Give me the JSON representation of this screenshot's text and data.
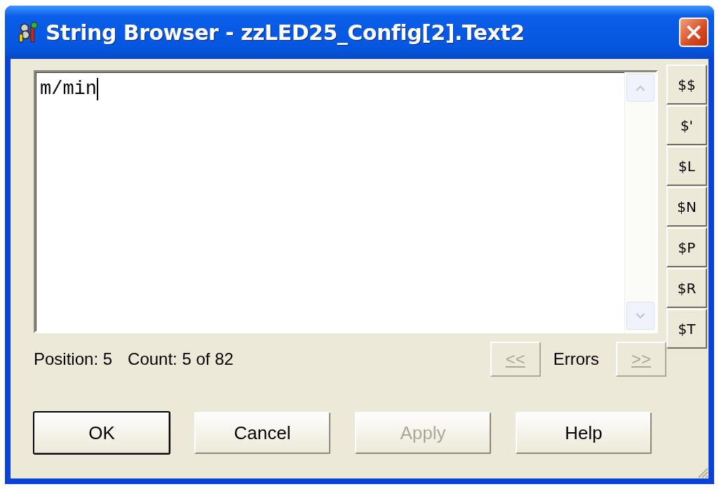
{
  "window": {
    "title": "String Browser - zzLED25_Config[2].Text2"
  },
  "editor": {
    "value": "m/min"
  },
  "code_buttons": [
    {
      "label": "$$"
    },
    {
      "label": "$'"
    },
    {
      "label": "$L"
    },
    {
      "label": "$N"
    },
    {
      "label": "$P"
    },
    {
      "label": "$R"
    },
    {
      "label": "$T"
    }
  ],
  "status": {
    "position": "Position: 5",
    "count": "Count: 5 of 82"
  },
  "errors": {
    "previous": {
      "label": "<<",
      "disabled": true
    },
    "label": "Errors",
    "next": {
      "label": ">>",
      "disabled": true
    }
  },
  "buttons": [
    {
      "label": "OK",
      "default": true,
      "disabled": false
    },
    {
      "label": "Cancel",
      "default": false,
      "disabled": false
    },
    {
      "label": "Apply",
      "default": false,
      "disabled": true
    },
    {
      "label": "Help",
      "default": false,
      "disabled": false
    }
  ]
}
